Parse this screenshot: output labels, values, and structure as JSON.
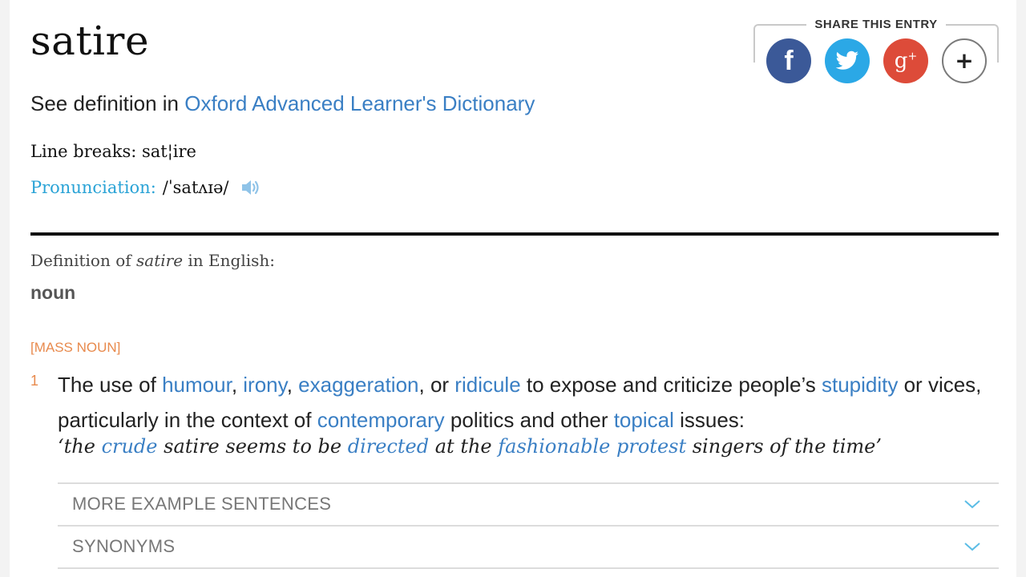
{
  "entry": {
    "headword": "satire",
    "see_definition": {
      "prefix": "See definition in ",
      "link": "Oxford Advanced Learner's Dictionary"
    },
    "line_breaks": {
      "label": "Line breaks: ",
      "value": "sat¦ire"
    },
    "pronunciation": {
      "label": "Pronunciation:",
      "ipa": "/ˈsatʌɪə/",
      "audio_icon": "speaker-icon"
    }
  },
  "share": {
    "title": "SHARE THIS ENTRY",
    "buttons": [
      {
        "name": "facebook",
        "glyph": "f",
        "color": "#3b5998"
      },
      {
        "name": "twitter",
        "glyph": "twitter-bird",
        "color": "#2ba8e6"
      },
      {
        "name": "google-plus",
        "glyph": "g+",
        "color": "#dd4b39"
      },
      {
        "name": "more",
        "glyph": "+",
        "color": "#ffffff"
      }
    ]
  },
  "definition": {
    "heading_prefix": "Definition of ",
    "heading_word": "satire",
    "heading_suffix": " in English:",
    "part_of_speech": "noun",
    "grammar_label": "[MASS NOUN]",
    "senses": [
      {
        "number": "1",
        "parts": [
          {
            "t": "The use of ",
            "link": false
          },
          {
            "t": "humour",
            "link": true
          },
          {
            "t": ", ",
            "link": false
          },
          {
            "t": "irony",
            "link": true
          },
          {
            "t": ", ",
            "link": false
          },
          {
            "t": "exaggeration",
            "link": true
          },
          {
            "t": ", or ",
            "link": false
          },
          {
            "t": "ridicule",
            "link": true
          },
          {
            "t": " to expose and criticize people’s ",
            "link": false
          },
          {
            "t": "stupidity",
            "link": true
          },
          {
            "t": " or vices, particularly in the context of ",
            "link": false
          },
          {
            "t": "contemporary",
            "link": true
          },
          {
            "t": " politics and other ",
            "link": false
          },
          {
            "t": "topical",
            "link": true
          },
          {
            "t": " issues:",
            "link": false
          }
        ],
        "example": [
          {
            "t": "‘the ",
            "link": false
          },
          {
            "t": "crude",
            "link": true
          },
          {
            "t": " satire seems to be ",
            "link": false
          },
          {
            "t": "directed",
            "link": true
          },
          {
            "t": " at the ",
            "link": false
          },
          {
            "t": "fashionable",
            "link": true
          },
          {
            "t": " ",
            "link": false
          },
          {
            "t": "protest",
            "link": true
          },
          {
            "t": " singers of the time’",
            "link": false
          }
        ]
      }
    ],
    "accordions": [
      {
        "label": "MORE EXAMPLE SENTENCES",
        "icon": "chevron-down-icon"
      },
      {
        "label": "SYNONYMS",
        "icon": "chevron-down-icon"
      }
    ]
  },
  "colors": {
    "link": "#3a7fc4",
    "pronunciation_label": "#2aa3d6",
    "grammar": "#e88a4d",
    "chevron": "#5bbde6"
  }
}
